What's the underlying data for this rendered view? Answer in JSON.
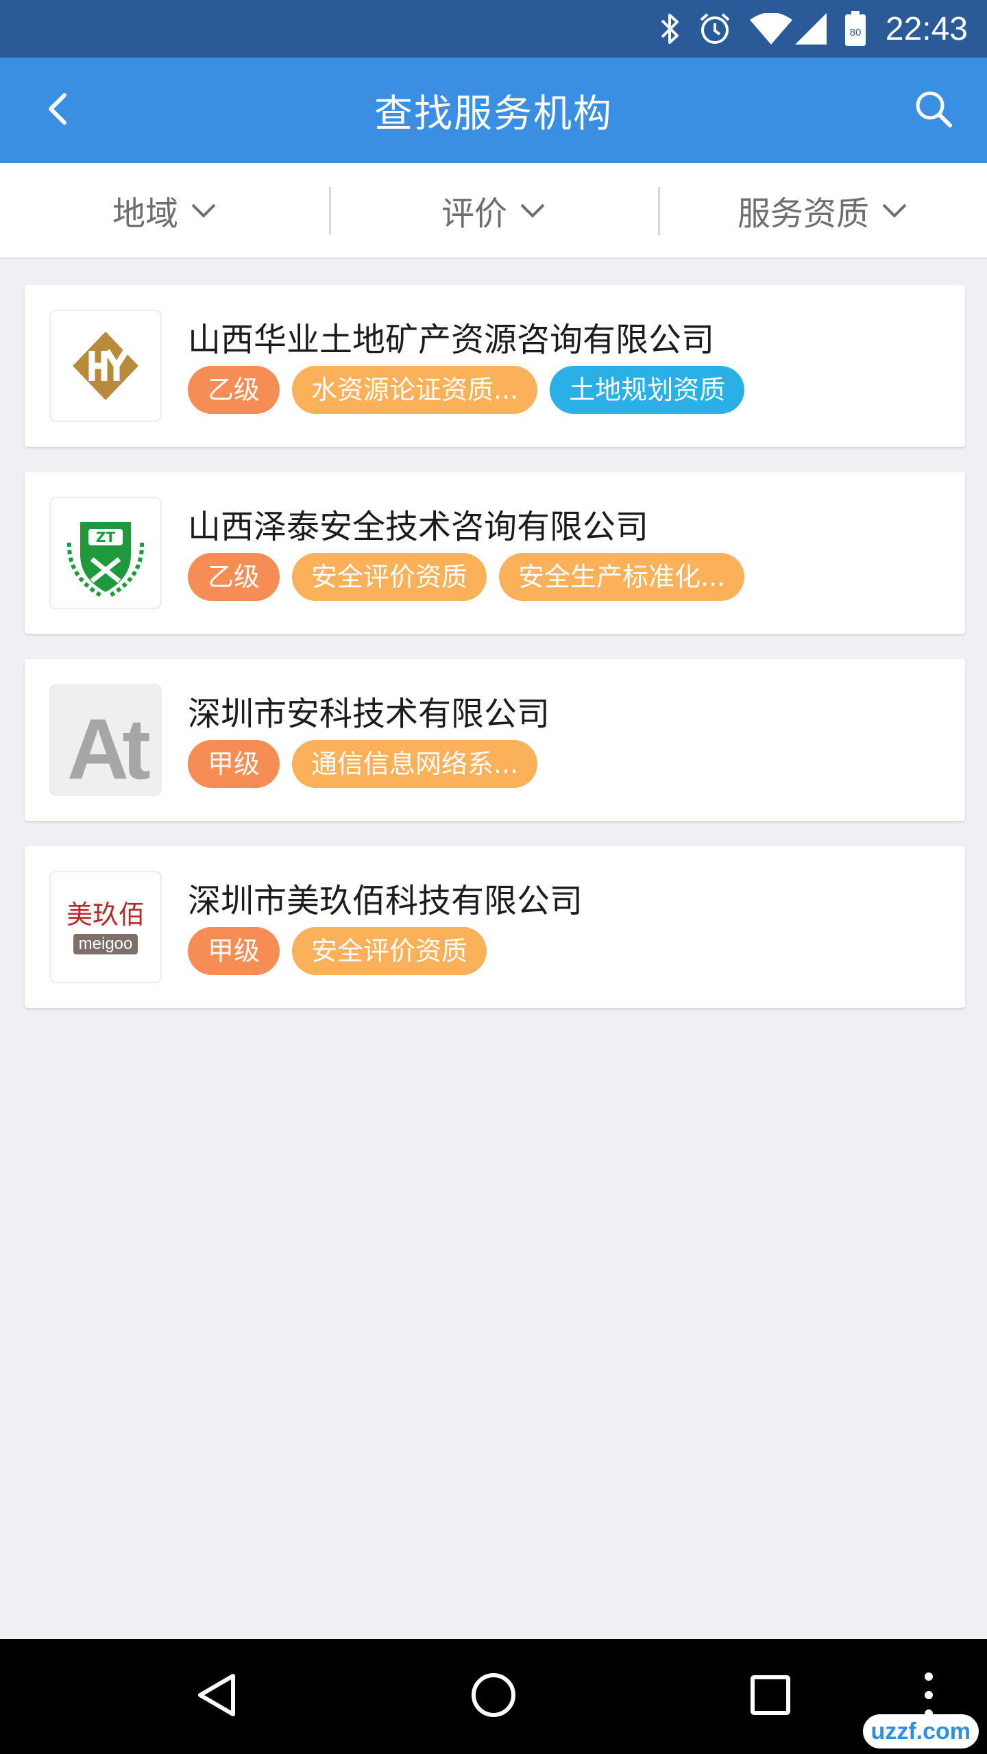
{
  "status_bar": {
    "time": "22:43",
    "battery_level": "80",
    "icons": [
      "bluetooth-icon",
      "alarm-icon",
      "wifi-icon",
      "signal-icon",
      "battery-icon"
    ]
  },
  "header": {
    "title": "查找服务机构",
    "back_icon": "chevron-left-icon",
    "search_icon": "search-icon",
    "background": "#3a8fe3"
  },
  "filters": [
    {
      "label": "地域",
      "icon": "chevron-down-icon"
    },
    {
      "label": "评价",
      "icon": "chevron-down-icon"
    },
    {
      "label": "服务资质",
      "icon": "chevron-down-icon"
    }
  ],
  "organizations": [
    {
      "name": "山西华业土地矿产资源咨询有限公司",
      "logo": {
        "type": "hy-logo"
      },
      "tags": [
        {
          "text": "乙级",
          "kind": "grade"
        },
        {
          "text": "水资源论证资质...",
          "kind": "qual"
        },
        {
          "text": "土地规划资质",
          "kind": "blue"
        }
      ]
    },
    {
      "name": "山西泽泰安全技术咨询有限公司",
      "logo": {
        "type": "zt-logo",
        "text": "ZT"
      },
      "tags": [
        {
          "text": "乙级",
          "kind": "grade"
        },
        {
          "text": "安全评价资质",
          "kind": "qual"
        },
        {
          "text": "安全生产标准化...",
          "kind": "qual"
        }
      ]
    },
    {
      "name": "深圳市安科技术有限公司",
      "logo": {
        "type": "at-logo",
        "text": "At"
      },
      "tags": [
        {
          "text": "甲级",
          "kind": "grade"
        },
        {
          "text": "通信信息网络系...",
          "kind": "qual"
        }
      ]
    },
    {
      "name": "深圳市美玖佰科技有限公司",
      "logo": {
        "type": "meigoo-logo",
        "text": "美玖佰",
        "subtext": "meigoo"
      },
      "tags": [
        {
          "text": "甲级",
          "kind": "grade"
        },
        {
          "text": "安全评价资质",
          "kind": "qual"
        }
      ]
    }
  ],
  "tag_colors": {
    "grade": "#f58d54",
    "qual": "#fbb05a",
    "blue": "#2ab0e5"
  },
  "nav_bar": {
    "buttons": [
      "back-triangle-icon",
      "home-circle-icon",
      "recents-square-icon",
      "more-dots-icon"
    ]
  },
  "watermark": "uzzf.com"
}
